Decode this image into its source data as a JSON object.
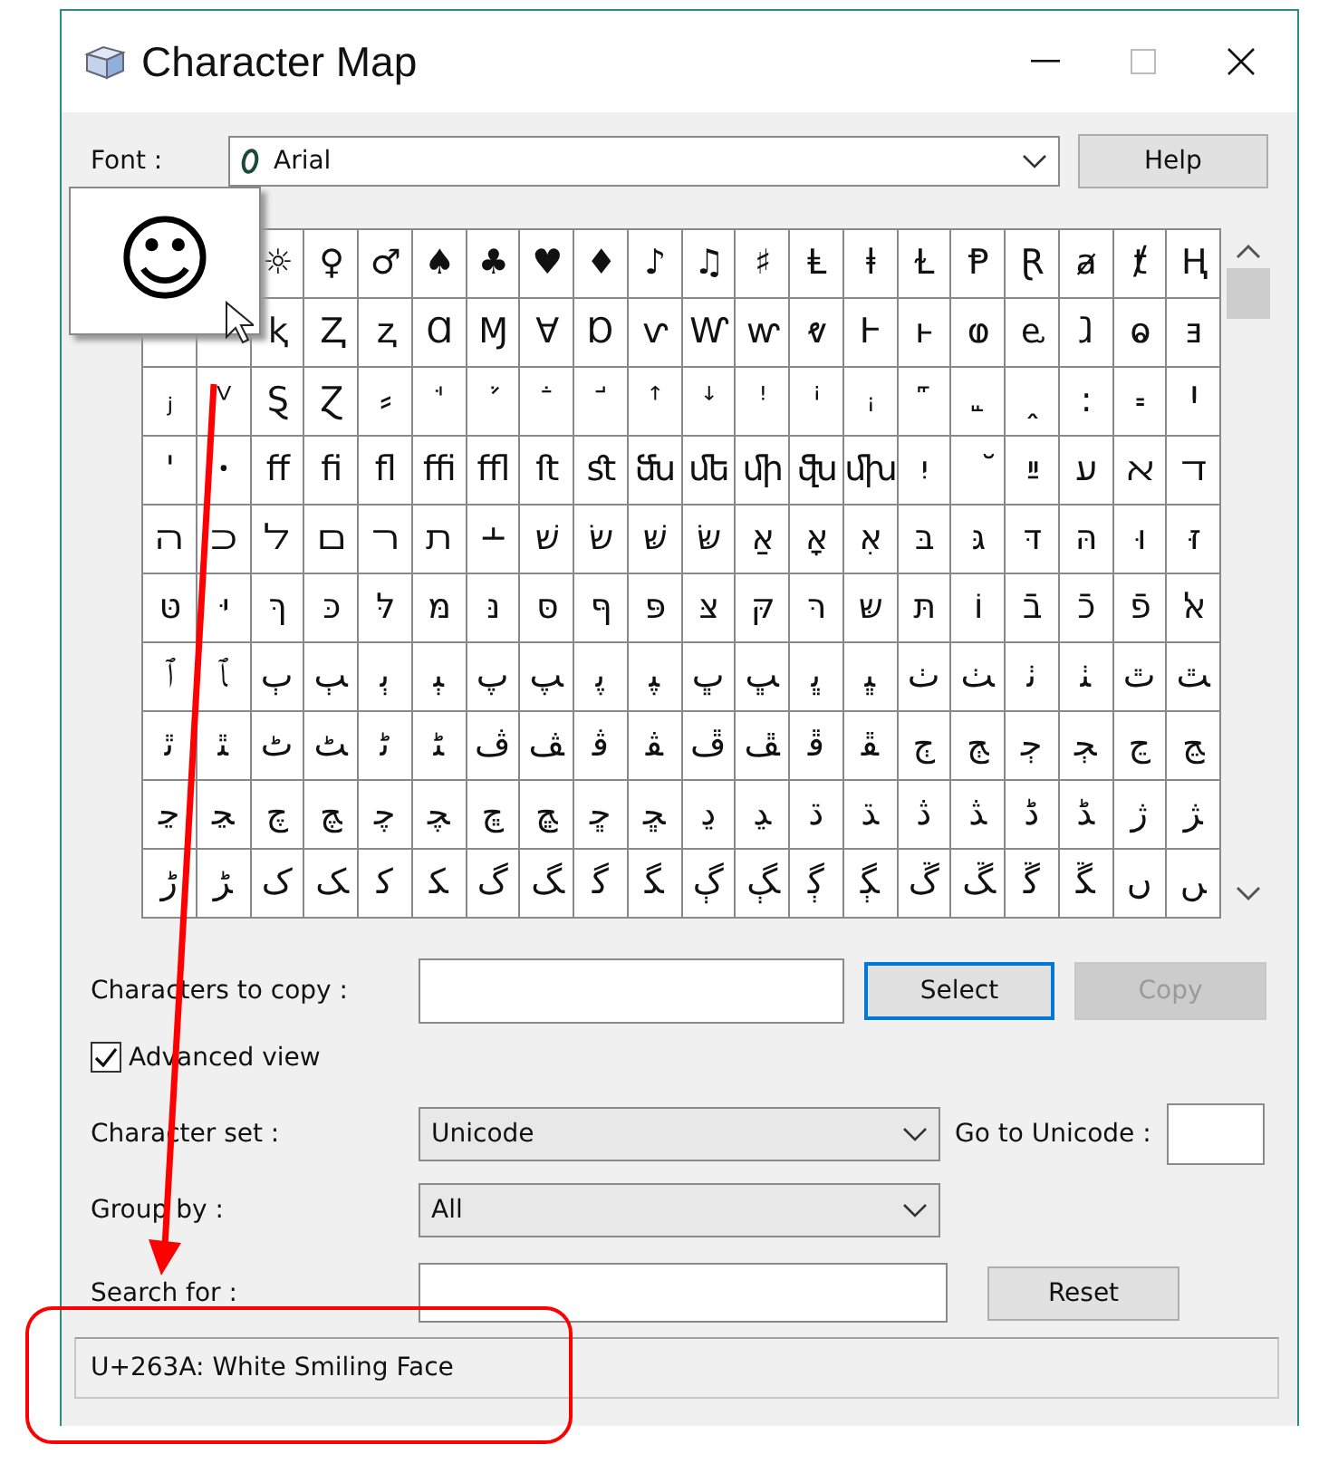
{
  "window": {
    "title": "Character Map"
  },
  "font": {
    "label": "Font :",
    "value": "Arial"
  },
  "help_button": "Help",
  "grid": {
    "rows": [
      [
        "☼",
        "♀",
        "♂",
        "♠",
        "♣",
        "♥",
        "♦",
        "♪",
        "♫",
        "♯",
        "Ⱡ",
        "ⱡ",
        "Ɫ",
        "Ᵽ",
        "Ɽ",
        "ⱥ",
        "ⱦ",
        "Ⱨ"
      ],
      [
        "ⱪ",
        "Ⱬ",
        "ⱬ",
        "Ɑ",
        "Ɱ",
        "Ɐ",
        "Ɒ",
        "ⱱ",
        "Ⱳ",
        "ⱳ",
        "ⱴ",
        "Ⱶ",
        "ⱶ",
        "ⱷ",
        "ⱸ",
        "ⱹ",
        "ⱺ",
        "ⱻ"
      ],
      [
        "ⱼ",
        "ⱽ",
        "Ȿ",
        "Ɀ",
        "⸗",
        "ꜗ",
        "ꜘ",
        "ꜙ",
        "ꜚ",
        "ꜛ",
        "ꜜ",
        "ꜝ",
        "ꜞ",
        "ꜟ",
        "꜠",
        "꜡",
        "ꞈ",
        "꞉",
        "꞊",
        "Ꞌ"
      ],
      [
        "ꞌ",
        "ꞏ",
        "ﬀ",
        "ﬁ",
        "ﬂ",
        "ﬃ",
        "ﬄ",
        "ﬅ",
        "ﬆ",
        "ﬓ",
        "ﬔ",
        "ﬕ",
        "ﬖ",
        "ﬗ",
        "יִ",
        "ﬞ",
        "ײַ",
        "ﬠ",
        "ﬡ",
        "ﬢ"
      ],
      [
        "ﬣ",
        "ﬤ",
        "ﬥ",
        "ﬦ",
        "ﬧ",
        "ﬨ",
        "﬩",
        "שׁ",
        "שׂ",
        "שּׁ",
        "שּׂ",
        "אַ",
        "אָ",
        "אּ",
        "בּ",
        "גּ",
        "דּ",
        "הּ",
        "וּ",
        "זּ"
      ],
      [
        "טּ",
        "יּ",
        "ךּ",
        "כּ",
        "לּ",
        "מּ",
        "נּ",
        "סּ",
        "ףּ",
        "פּ",
        "צּ",
        "קּ",
        "רּ",
        "שּ",
        "תּ",
        "וֹ",
        "בֿ",
        "כֿ",
        "פֿ",
        "ﭏ"
      ],
      [
        "ﭐ",
        "ﭑ",
        "ﭒ",
        "ﭓ",
        "ﭔ",
        "ﭕ",
        "ﭖ",
        "ﭗ",
        "ﭘ",
        "ﭙ",
        "ﭚ",
        "ﭛ",
        "ﭜ",
        "ﭝ",
        "ﭞ",
        "ﭟ",
        "ﭠ",
        "ﭡ",
        "ﭢ",
        "ﭣ"
      ],
      [
        "ﭤ",
        "ﭥ",
        "ﭦ",
        "ﭧ",
        "ﭨ",
        "ﭩ",
        "ﭪ",
        "ﭫ",
        "ﭬ",
        "ﭭ",
        "ﭮ",
        "ﭯ",
        "ﭰ",
        "ﭱ",
        "ﭲ",
        "ﭳ",
        "ﭴ",
        "ﭵ",
        "ﭶ",
        "ﭷ"
      ],
      [
        "ﭸ",
        "ﭹ",
        "ﭺ",
        "ﭻ",
        "ﭼ",
        "ﭽ",
        "ﭾ",
        "ﭿ",
        "ﮀ",
        "ﮁ",
        "ﮂ",
        "ﮃ",
        "ﮄ",
        "ﮅ",
        "ﮆ",
        "ﮇ",
        "ﮈ",
        "ﮉ",
        "ﮊ",
        "ﮋ"
      ],
      [
        "ﮌ",
        "ﮍ",
        "ﮎ",
        "ﮏ",
        "ﮐ",
        "ﮑ",
        "ﮒ",
        "ﮓ",
        "ﮔ",
        "ﮕ",
        "ﮖ",
        "ﮗ",
        "ﮘ",
        "ﮙ",
        "ﮚ",
        "ﮛ",
        "ﮜ",
        "ﮝ",
        "ﮞ",
        "ﮟ"
      ]
    ]
  },
  "preview": {
    "char": "☺"
  },
  "copy": {
    "label": "Characters to copy :"
  },
  "buttons": [
    {
      "label": "Select",
      "focused": true,
      "disabled": false
    },
    {
      "label": "Copy",
      "focused": false,
      "disabled": true
    }
  ],
  "advanced_view": {
    "label": "Advanced view",
    "checked": true
  },
  "character_set": {
    "label": "Character set :",
    "value": "Unicode"
  },
  "go_to_unicode": {
    "label": "Go to Unicode :"
  },
  "group_by": {
    "label": "Group by :",
    "value": "All"
  },
  "search": {
    "label": "Search for :"
  },
  "reset_button": "Reset",
  "status_bar": "U+263A: White Smiling Face"
}
